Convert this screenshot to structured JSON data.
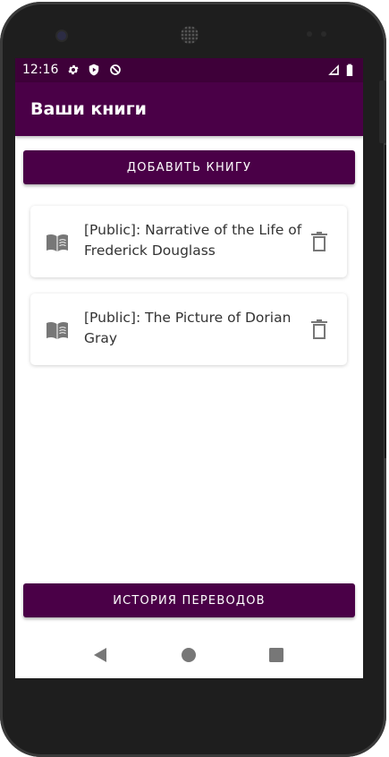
{
  "status": {
    "time": "12:16",
    "icons": [
      "settings-icon",
      "shield-icon",
      "no-sync-icon",
      "signal-icon",
      "battery-icon"
    ]
  },
  "appbar": {
    "title": "Ваши книги"
  },
  "actions": {
    "add_book_label": "ДОБАВИТЬ КНИГУ",
    "history_label": "ИСТОРИЯ ПЕРЕВОДОВ"
  },
  "books": [
    {
      "title": "[Public]: Narrative of the Life of Frederick Douglass",
      "icon": "book-icon",
      "action_icon": "trash-icon"
    },
    {
      "title": "[Public]: The Picture of Dorian Gray",
      "icon": "book-icon",
      "action_icon": "trash-icon"
    }
  ],
  "navigation": {
    "items": [
      "back-icon",
      "home-icon",
      "recents-icon"
    ]
  },
  "colors": {
    "primary": "#4a0047",
    "status_bar": "#3e0039",
    "icon_gray": "#777777"
  }
}
